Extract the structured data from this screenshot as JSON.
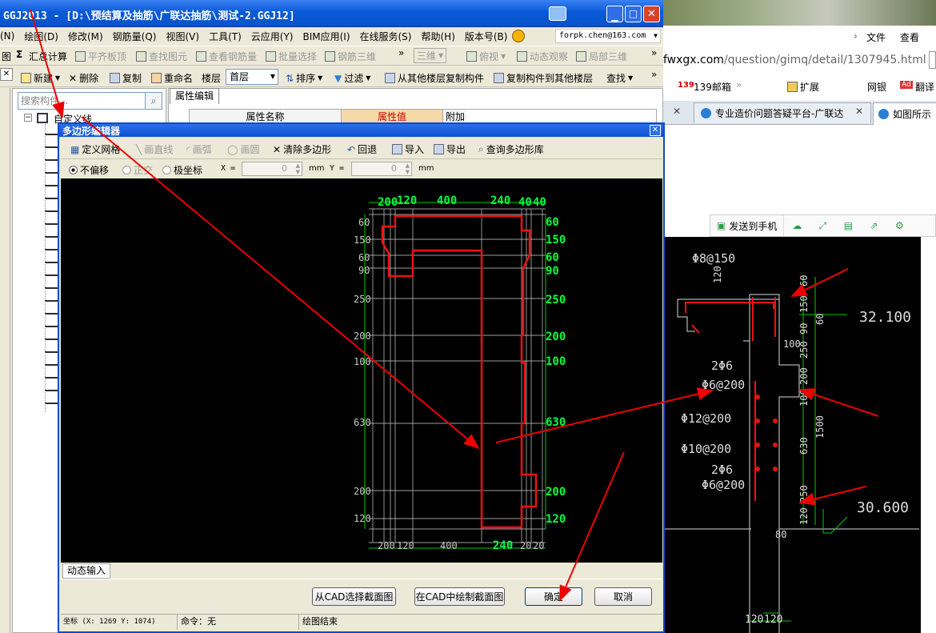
{
  "app": {
    "title": "GGJ2013 - [D:\\预结算及抽筋\\广联达抽筋\\测试-2.GGJ12]",
    "menu": [
      "(N)",
      "绘图(D)",
      "修改(M)",
      "钢筋量(Q)",
      "视图(V)",
      "工具(T)",
      "云应用(Y)",
      "BIM应用(I)",
      "在线服务(S)",
      "帮助(H)",
      "版本号(B)"
    ],
    "user_email": "forpk.chen@163.com",
    "toolbar1": [
      "图",
      "汇总计算",
      "平齐板顶",
      "查找图元",
      "查看钢筋量",
      "批量选择",
      "钢筋三维",
      "三维",
      "俯视",
      "动态观察",
      "局部三维"
    ],
    "toolbar2": [
      "新建",
      "删除",
      "复制",
      "重命名",
      "楼层",
      "首层",
      "排序",
      "过滤",
      "从其他楼层复制构件",
      "复制构件到其他楼层",
      "查找"
    ],
    "search_placeholder": "搜索构件...",
    "tree_root": "自定义线",
    "prop_tab": "属性编辑",
    "prop_headers": [
      "属性名称",
      "属性值",
      "附加"
    ]
  },
  "browser": {
    "url_prefix": "fwxgx.com",
    "url_path": "/question/gimq/detail/1307945.html",
    "menu": [
      "文件",
      "查看"
    ],
    "toolbar": [
      "139邮箱",
      "扩展",
      "网银",
      "翻译"
    ],
    "tabs": [
      "专业造价问题答疑平台-广联达",
      "如图所示"
    ],
    "send_to_phone": "发送到手机"
  },
  "dialog": {
    "title": "多边形编辑器",
    "tools": [
      "定义网格",
      "画直线",
      "画弧",
      "画圆",
      "清除多边形",
      "回退",
      "导入",
      "导出",
      "查询多边形库"
    ],
    "modes": [
      "不偏移",
      "正交",
      "极坐标"
    ],
    "x_label": "X =",
    "x_value": "0",
    "y_label": "Y =",
    "y_value": "0",
    "unit": "mm",
    "dyn_tab": "动态输入",
    "buttons": [
      "从CAD选择截面图",
      "在CAD中绘制截面图",
      "确定",
      "取消"
    ],
    "status": [
      "坐标 (X: 1269 Y: 1074)",
      "命令：无",
      "绘图结束"
    ]
  },
  "canvas": {
    "top_labels": [
      "200",
      "120",
      "400",
      "240",
      "40",
      "40"
    ],
    "bottom_labels": [
      "200",
      "120",
      "400",
      "240",
      "20",
      "20"
    ],
    "left_labels": [
      "60",
      "150",
      "60",
      "90",
      "250",
      "200",
      "100",
      "630",
      "200",
      "120"
    ],
    "right_labels": [
      "60",
      "150",
      "60",
      "90",
      "250",
      "200",
      "100",
      "630",
      "200",
      "120"
    ]
  },
  "cad": {
    "labels": [
      "Φ8@150",
      "120",
      "60",
      "150",
      "90",
      "60",
      "32.100",
      "2Φ6",
      "Φ6@200",
      "100",
      "250",
      "200",
      "100",
      "Φ12@200",
      "Φ10@200",
      "1500",
      "630",
      "2Φ6",
      "Φ6@200",
      "250",
      "120",
      "30.600",
      "80",
      "120",
      "120"
    ]
  }
}
